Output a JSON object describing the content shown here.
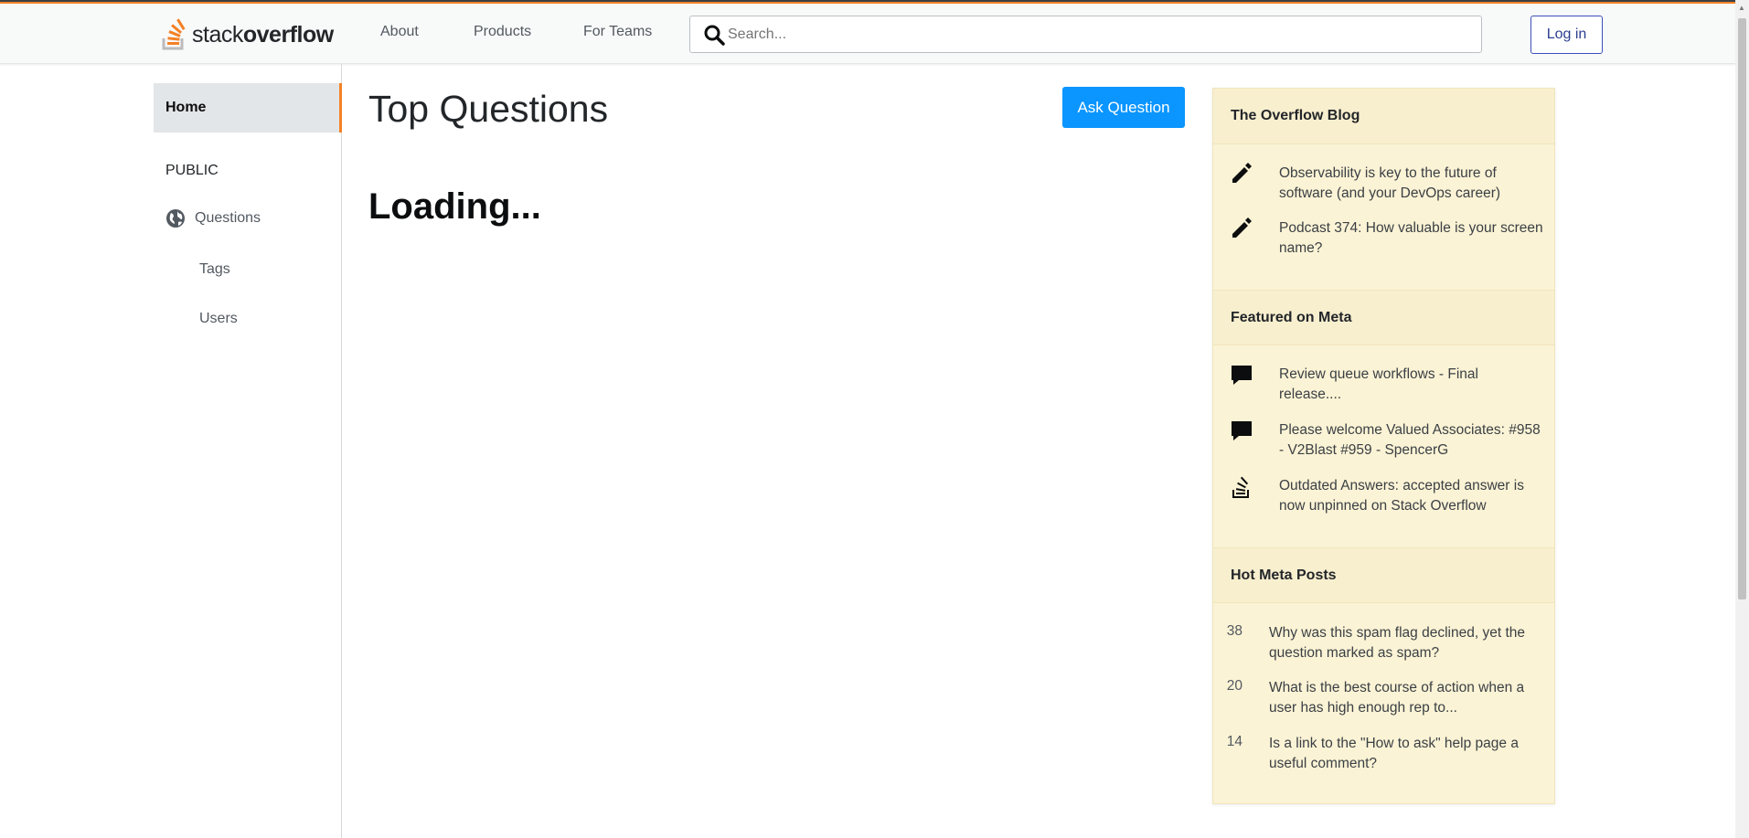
{
  "header": {
    "logo_text_light": "stack",
    "logo_text_bold": "overflow",
    "nav": {
      "about": "About",
      "products": "Products",
      "for_teams": "For Teams"
    },
    "search_placeholder": "Search...",
    "login_label": "Log in"
  },
  "sidebar": {
    "home": "Home",
    "section_public": "PUBLIC",
    "items": [
      {
        "label": "Questions",
        "icon": "globe-icon"
      },
      {
        "label": "Tags"
      },
      {
        "label": "Users"
      }
    ]
  },
  "main": {
    "title": "Top Questions",
    "ask_button": "Ask Question",
    "loading": "Loading..."
  },
  "widget": {
    "blog": {
      "title": "The Overflow Blog",
      "items": [
        {
          "icon": "pencil-icon",
          "text": "Observability is key to the future of software (and your DevOps career)"
        },
        {
          "icon": "pencil-icon",
          "text": "Podcast 374: How valuable is your screen name?"
        }
      ]
    },
    "meta": {
      "title": "Featured on Meta",
      "items": [
        {
          "icon": "comment-icon",
          "text": "Review queue workflows - Final release...."
        },
        {
          "icon": "comment-icon",
          "text": "Please welcome Valued Associates: #958 - V2Blast #959 - SpencerG"
        },
        {
          "icon": "stack-exchange-icon",
          "text": "Outdated Answers: accepted answer is now unpinned on Stack Overflow"
        }
      ]
    },
    "hot": {
      "title": "Hot Meta Posts",
      "items": [
        {
          "count": "38",
          "text": "Why was this spam flag declined, yet the question marked as spam?"
        },
        {
          "count": "20",
          "text": "What is the best course of action when a user has high enough rep to..."
        },
        {
          "count": "14",
          "text": "Is a link to the \"How to ask\" help page a useful comment?"
        }
      ]
    }
  },
  "colors": {
    "accent": "#f48225",
    "primary_button": "#0a95ff",
    "widget_bg": "#fbf3d5"
  }
}
